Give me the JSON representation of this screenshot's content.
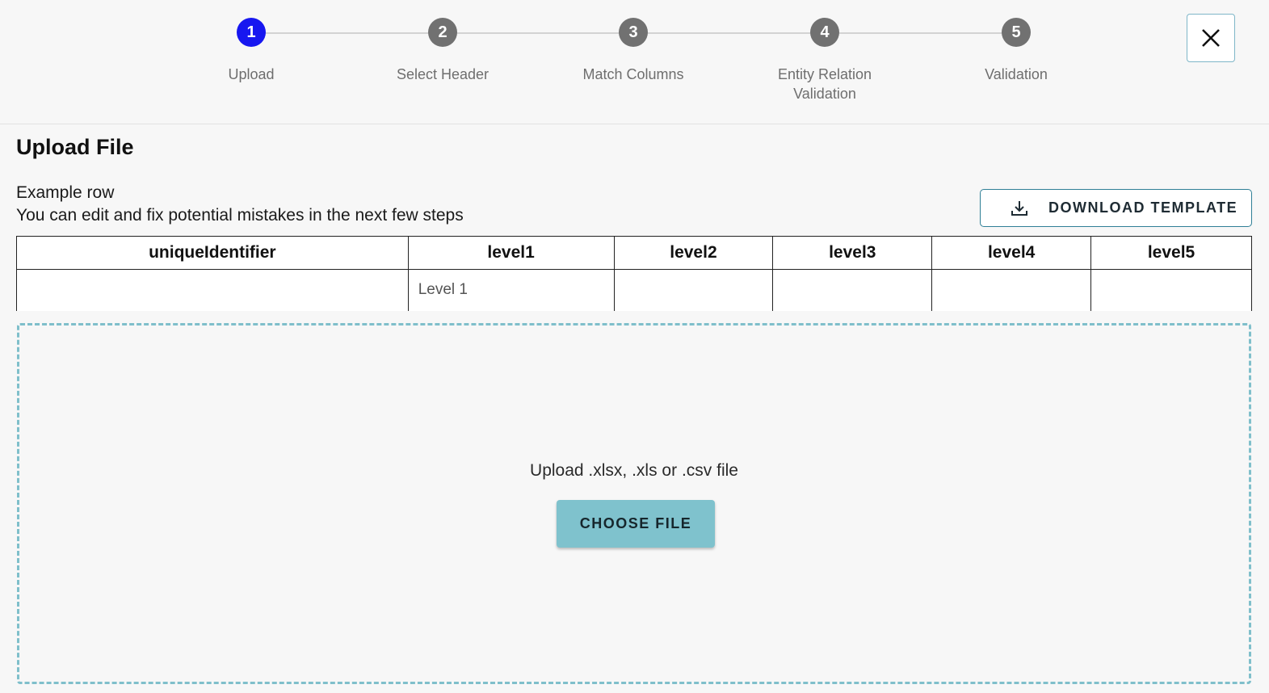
{
  "stepper": {
    "steps": [
      {
        "number": "1",
        "label": "Upload",
        "active": true
      },
      {
        "number": "2",
        "label": "Select Header",
        "active": false
      },
      {
        "number": "3",
        "label": "Match Columns",
        "active": false
      },
      {
        "number": "4",
        "label": "Entity Relation Validation",
        "active": false
      },
      {
        "number": "5",
        "label": "Validation",
        "active": false
      }
    ],
    "active_color": "#1717f0",
    "inactive_color": "#717171"
  },
  "close_icon": "close-icon",
  "main": {
    "title": "Upload File",
    "example_label": "Example row",
    "example_hint": "You can edit and fix potential mistakes in the next few steps",
    "download_button": {
      "label": "DOWNLOAD TEMPLATE",
      "icon": "download-icon"
    }
  },
  "example_table": {
    "columns": [
      "uniqueIdentifier",
      "level1",
      "level2",
      "level3",
      "level4",
      "level5"
    ],
    "row": [
      "",
      "Level 1",
      "",
      "",
      "",
      ""
    ]
  },
  "dropzone": {
    "text": "Upload .xlsx, .xls or .csv file",
    "button_label": "CHOOSE FILE",
    "accent_color": "#7fc2cd"
  }
}
